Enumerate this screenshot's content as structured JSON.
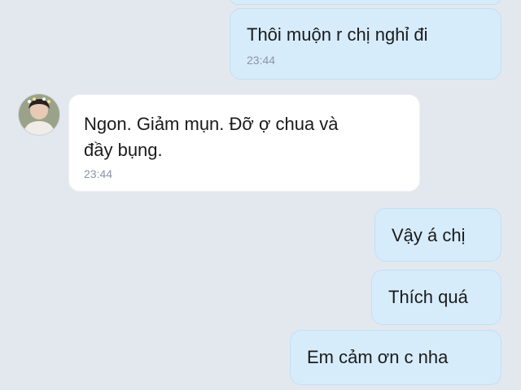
{
  "messages": [
    {
      "text": "Thôi muộn r chị nghỉ đi",
      "time": "23:44"
    },
    {
      "text_line1": "Ngon. Giảm mụn. Đỡ ợ chua và",
      "text_line2": "đầy bụng.",
      "time": "23:44"
    },
    {
      "text": "Vậy á chị"
    },
    {
      "text": "Thích quá"
    },
    {
      "text": "Em cảm ơn c nha"
    }
  ],
  "contact": {
    "avatar_icon": "profile-photo"
  }
}
